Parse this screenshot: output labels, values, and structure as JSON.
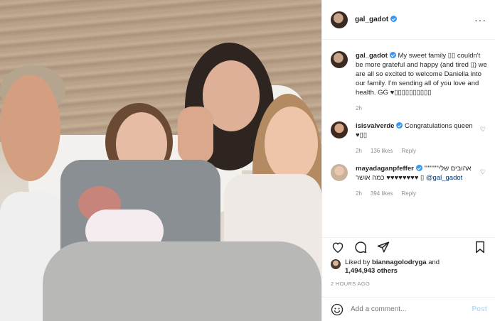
{
  "post": {
    "username": "gal_gadot",
    "more_icon": "ellipsis-icon"
  },
  "caption": {
    "username": "gal_gadot",
    "text": "My sweet family ▯▯ couldn't be more grateful and happy (and tired ▯) we are all so excited to welcome Daniella into our family. I'm sending all of you love and health. GG ♥▯▯▯▯▯▯▯▯▯▯",
    "time": "2h"
  },
  "comments": [
    {
      "username": "isisvalverde",
      "text": "Congratulations queen ♥▯▯",
      "time": "2h",
      "likes": "136 likes",
      "reply": "Reply"
    },
    {
      "username": "mayadaganpfeffer",
      "text": "אהובים שלי\"\"\"\"\"\" ♥♥♥♥♥♥♥♥ כמה אושר ▯",
      "mention": "@gal_gadot",
      "time": "2h",
      "likes": "394 likes",
      "reply": "Reply"
    }
  ],
  "likes": {
    "prefix": "Liked by ",
    "user": "biannagolodryga",
    "mid": " and",
    "count": "1,494,943 others"
  },
  "timestamp": "2 HOURS AGO",
  "add_comment": {
    "placeholder": "Add a comment...",
    "post_label": "Post"
  },
  "colors": {
    "accent": "#3897f0",
    "muted": "#8e8e8e",
    "post_disabled": "#b2dffc"
  }
}
